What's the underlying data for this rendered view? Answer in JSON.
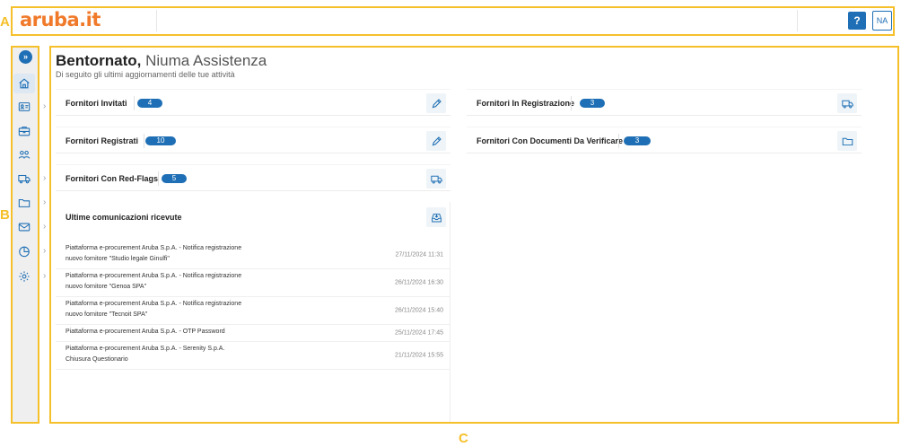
{
  "annotations": {
    "a": "A",
    "b": "B",
    "c": "C"
  },
  "header": {
    "logo_text": "aruba.it",
    "help_label": "?",
    "user_initials": "NA"
  },
  "sidebar": {
    "expand_label": "»",
    "chevron": "›",
    "items": [
      {
        "icon": "home-icon"
      },
      {
        "icon": "id-card-icon"
      },
      {
        "icon": "briefcase-icon"
      },
      {
        "icon": "users-icon"
      },
      {
        "icon": "truck-icon"
      },
      {
        "icon": "folder-icon"
      },
      {
        "icon": "mail-icon"
      },
      {
        "icon": "chart-pie-icon"
      },
      {
        "icon": "gear-icon"
      }
    ]
  },
  "welcome": {
    "greeting": "Bentornato,",
    "name": "Niuma Assistenza",
    "subtitle": "Di seguito gli ultimi aggiornamenti delle tue attività"
  },
  "cards": {
    "invitati": {
      "title": "Fornitori Invitati",
      "count": "4",
      "icon": "pencil-icon"
    },
    "in_registrazione": {
      "title": "Fornitori In Registrazione",
      "count": "3",
      "icon": "truck-icon"
    },
    "registrati": {
      "title": "Fornitori Registrati",
      "count": "10",
      "icon": "pencil-icon"
    },
    "documenti": {
      "title": "Fornitori Con Documenti Da Verificare",
      "count": "3",
      "icon": "folder-icon"
    },
    "red_flags": {
      "title": "Fornitori Con Red-Flags",
      "count": "5",
      "icon": "truck-icon"
    }
  },
  "communications": {
    "title": "Ultime comunicazioni ricevute",
    "icon": "inbox-icon",
    "items": [
      {
        "line1": "Piattaforma e-procurement Aruba S.p.A. - Notifica registrazione",
        "line2": "nuovo fornitore \"Studio legale Ginulfi\"",
        "date": "27/11/2024 11:31"
      },
      {
        "line1": "Piattaforma e-procurement Aruba S.p.A. - Notifica registrazione",
        "line2": "nuovo fornitore \"Genoa SPA\"",
        "date": "26/11/2024 16:30"
      },
      {
        "line1": "Piattaforma e-procurement Aruba S.p.A. - Notifica registrazione",
        "line2": "nuovo fornitore \"Tecnoit SPA\"",
        "date": "26/11/2024 15:40"
      },
      {
        "line1": "Piattaforma e-procurement Aruba S.p.A. - OTP Password",
        "line2": "",
        "date": "25/11/2024 17:45"
      },
      {
        "line1": "Piattaforma e-procurement Aruba S.p.A. - Serenity S.p.A.",
        "line2": "Chiusura Questionario",
        "date": "21/11/2024 15:55"
      }
    ]
  },
  "colors": {
    "accent": "#1e6fb5",
    "annotation": "#f5c02a",
    "logo": "#f07a2a"
  }
}
